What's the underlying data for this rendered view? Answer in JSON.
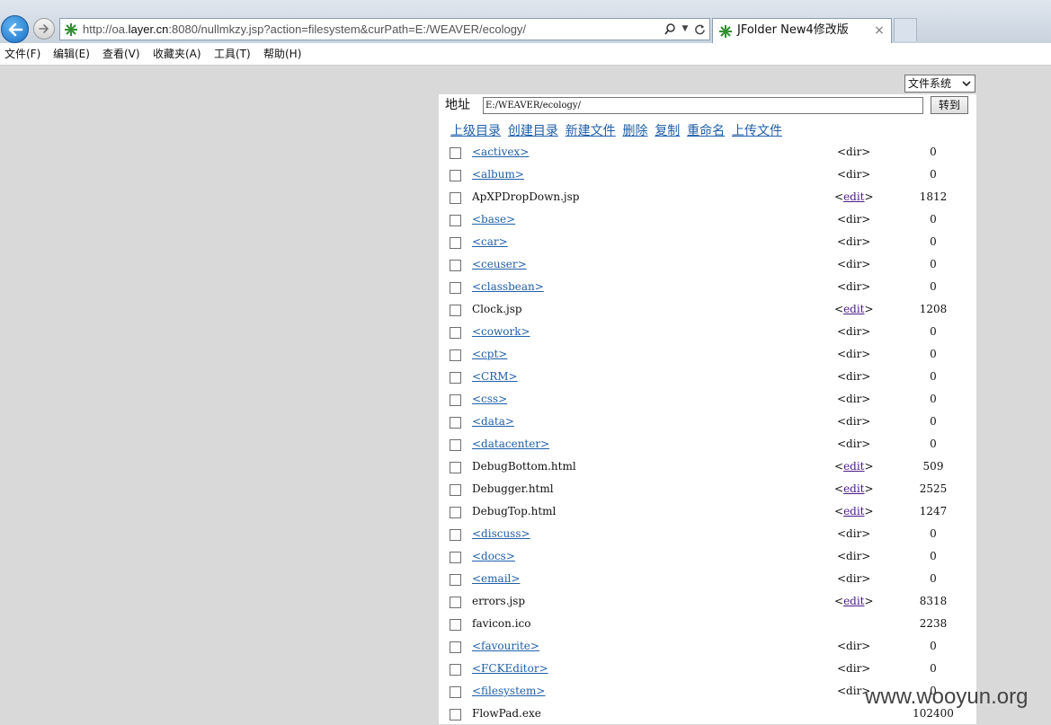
{
  "browser": {
    "url_prefix": "http://oa.",
    "url_domain": "layer.cn",
    "url_rest": ":8080/nullmkzy.jsp?action=filesystem&curPath=E:/WEAVER/ecology/",
    "tab_title": "JFolder New4修改版",
    "tab_close": "×"
  },
  "menu": [
    "文件(F)",
    "编辑(E)",
    "查看(V)",
    "收藏夹(A)",
    "工具(T)",
    "帮助(H)"
  ],
  "page": {
    "fs_select": "文件系统",
    "addr_label": "地址",
    "path_value": "E:/WEAVER/ecology/",
    "go_button": "转到",
    "actions": [
      "上级目录",
      "创建目录",
      "新建文件",
      "删除",
      "复制",
      "重命名",
      "上传文件"
    ],
    "files": [
      {
        "name": "<activex>",
        "dir": true,
        "type": "<dir>",
        "size": "0"
      },
      {
        "name": "<album>",
        "dir": true,
        "type": "<dir>",
        "size": "0"
      },
      {
        "name": "ApXPDropDown.jsp",
        "dir": false,
        "type": "edit",
        "size": "1812"
      },
      {
        "name": "<base>",
        "dir": true,
        "type": "<dir>",
        "size": "0"
      },
      {
        "name": "<car>",
        "dir": true,
        "type": "<dir>",
        "size": "0"
      },
      {
        "name": "<ceuser>",
        "dir": true,
        "type": "<dir>",
        "size": "0"
      },
      {
        "name": "<classbean>",
        "dir": true,
        "type": "<dir>",
        "size": "0"
      },
      {
        "name": "Clock.jsp",
        "dir": false,
        "type": "edit",
        "size": "1208"
      },
      {
        "name": "<cowork>",
        "dir": true,
        "type": "<dir>",
        "size": "0"
      },
      {
        "name": "<cpt>",
        "dir": true,
        "type": "<dir>",
        "size": "0"
      },
      {
        "name": "<CRM>",
        "dir": true,
        "type": "<dir>",
        "size": "0"
      },
      {
        "name": "<css>",
        "dir": true,
        "type": "<dir>",
        "size": "0"
      },
      {
        "name": "<data>",
        "dir": true,
        "type": "<dir>",
        "size": "0"
      },
      {
        "name": "<datacenter>",
        "dir": true,
        "type": "<dir>",
        "size": "0"
      },
      {
        "name": "DebugBottom.html",
        "dir": false,
        "type": "edit",
        "size": "509"
      },
      {
        "name": "Debugger.html",
        "dir": false,
        "type": "edit",
        "size": "2525"
      },
      {
        "name": "DebugTop.html",
        "dir": false,
        "type": "edit",
        "size": "1247"
      },
      {
        "name": "<discuss>",
        "dir": true,
        "type": "<dir>",
        "size": "0"
      },
      {
        "name": "<docs>",
        "dir": true,
        "type": "<dir>",
        "size": "0"
      },
      {
        "name": "<email>",
        "dir": true,
        "type": "<dir>",
        "size": "0"
      },
      {
        "name": "errors.jsp",
        "dir": false,
        "type": "edit",
        "size": "8318"
      },
      {
        "name": "favicon.ico",
        "dir": false,
        "type": "",
        "size": "2238"
      },
      {
        "name": "<favourite>",
        "dir": true,
        "type": "<dir>",
        "size": "0"
      },
      {
        "name": "<FCKEditor>",
        "dir": true,
        "type": "<dir>",
        "size": "0"
      },
      {
        "name": "<filesystem>",
        "dir": true,
        "type": "<dir>",
        "size": "0"
      },
      {
        "name": "FlowPad.exe",
        "dir": false,
        "type": "",
        "size": "102400"
      }
    ],
    "watermark": "www.wooyun.org"
  },
  "colors": {
    "link": "#1f5fa8",
    "visited": "#4c1a8a",
    "page_bg": "#d9d9d9"
  }
}
